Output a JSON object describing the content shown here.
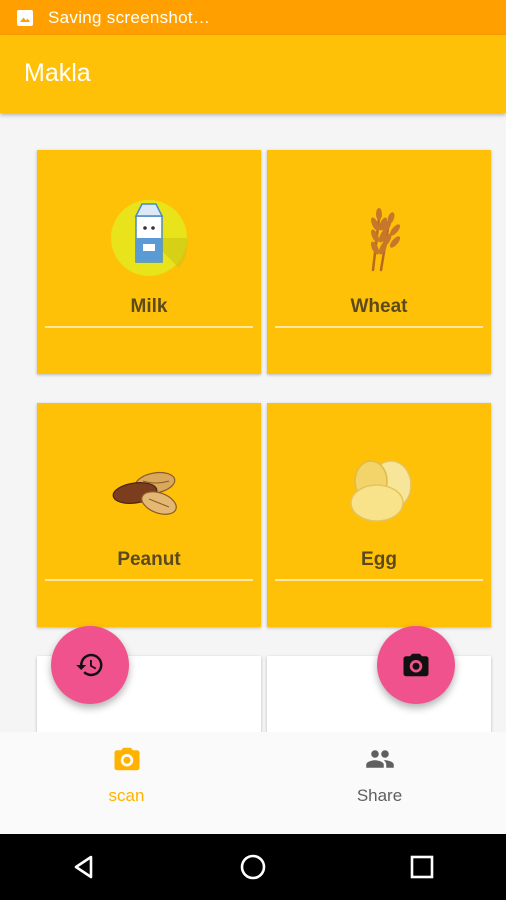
{
  "status_bar": {
    "text": "Saving screenshot…",
    "icon": "image-icon"
  },
  "app_bar": {
    "title": "Makla"
  },
  "cards": [
    {
      "label": "Milk",
      "icon": "milk-carton-icon"
    },
    {
      "label": "Wheat",
      "icon": "wheat-icon"
    },
    {
      "label": "Peanut",
      "icon": "peanut-icon"
    },
    {
      "label": "Egg",
      "icon": "egg-icon"
    },
    {
      "label": "",
      "icon": "pig-icon"
    },
    {
      "label": "",
      "icon": "bottle-icon"
    }
  ],
  "fabs": {
    "left_icon": "history-icon",
    "right_icon": "camera-icon"
  },
  "bottom_nav": {
    "items": [
      {
        "label": "scan",
        "icon": "camera-icon",
        "active": true
      },
      {
        "label": "Share",
        "icon": "people-icon",
        "active": false
      }
    ]
  },
  "system_nav": {
    "buttons": [
      "back-icon",
      "home-icon",
      "recents-icon"
    ]
  },
  "colors": {
    "status_bar": "#FFA000",
    "primary": "#FFC107",
    "fab": "#F0528D",
    "active_tab": "#FFB300"
  }
}
